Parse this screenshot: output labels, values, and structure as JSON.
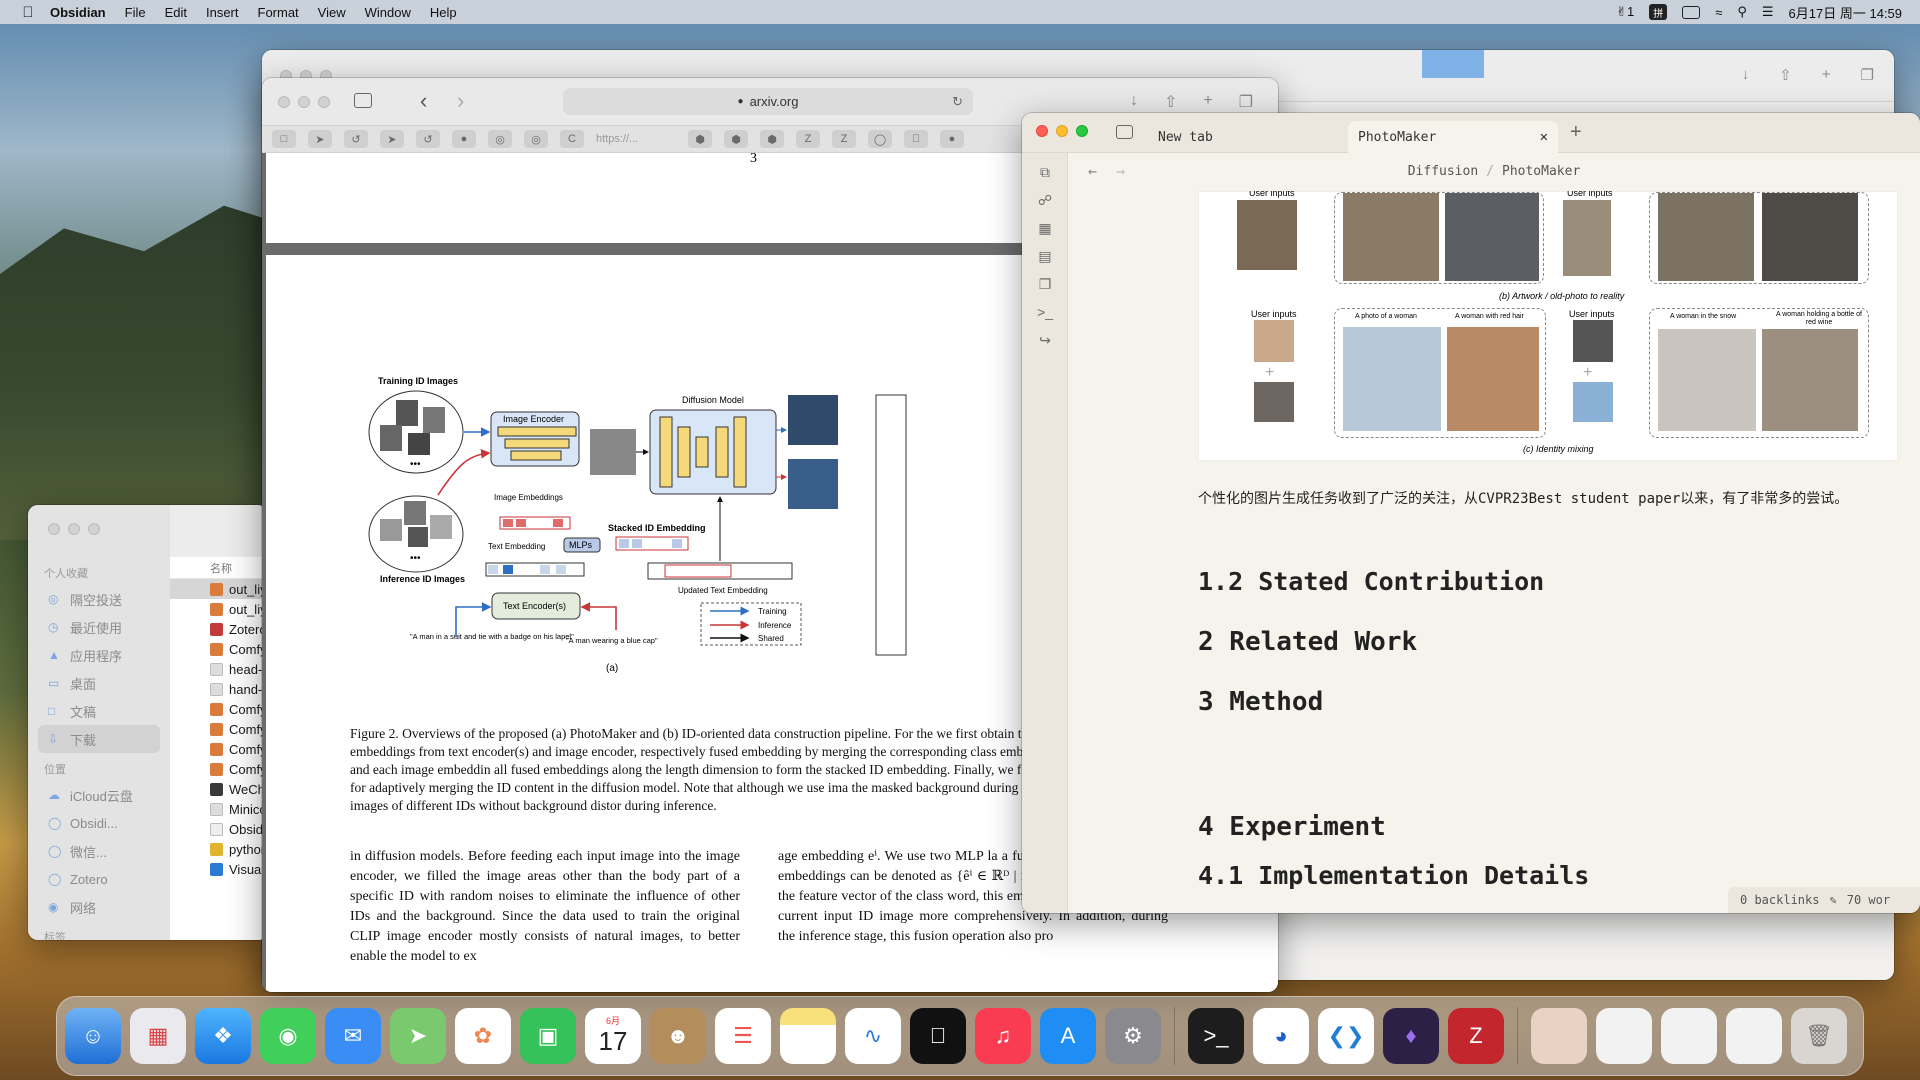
{
  "menubar": {
    "app": "Obsidian",
    "items": [
      "File",
      "Edit",
      "Insert",
      "Format",
      "View",
      "Window",
      "Help"
    ],
    "status": {
      "badge": "1",
      "input": "拼",
      "clock": "6月17日 周一 14:59"
    }
  },
  "safari": {
    "url": "arxiv.org",
    "fav_text": "https://...",
    "page_num": "3"
  },
  "figure": {
    "training_label": "Training ID Images",
    "inference_label": "Inference ID Images",
    "image_encoder": "Image Encoder",
    "diffusion": "Diffusion Model",
    "image_embeddings": "Image Embeddings",
    "text_embedding": "Text Embedding",
    "mlps": "MLPs",
    "stacked": "Stacked ID Embedding",
    "updated": "Updated Text Embedding",
    "text_encoder": "Text Encoder(s)",
    "prompt1": "\"A man in a suit and tie with a badge on his lapel\"",
    "prompt2": "\"A man wearing a blue cap\"",
    "legend": [
      "Training",
      "Inference",
      "Shared"
    ],
    "sub": "(a)",
    "colors": {
      "training": "#2d6fc2",
      "inference": "#c8363a",
      "shared": "#111111"
    }
  },
  "paper": {
    "caption": "Figure 2. Overviews of the proposed (a) PhotoMaker and (b) ID-oriented data construction pipeline. For the we first obtain the text embedding and image embeddings from text encoder(s) and image encoder, respectively fused embedding by merging the corresponding class embedding (e.g., man and woman) and each image embeddin all fused embeddings along the length dimension to form the stacked ID embedding. Finally, we feed the stack cross-attention layers for adaptively merging the ID content in the diffusion model. Note that although we use ima the masked background during training, we can directly input images of different IDs without background distor during inference.",
    "col1": "in diffusion models. Before feeding each input image into the image encoder, we filled the image areas other than the body part of a specific ID with random noises to eliminate the influence of other IDs and the background. Since the data used to train the original CLIP image encoder mostly consists of natural images, to better enable the model to ex",
    "col2": "age embedding eⁱ. We use two MLP la a fusion operation. The fused embeddings can be denoted as {êⁱ ∈ ℝᴰ | i = 1…N}. By combining the feature vector of the class word, this embedding can represent the current input ID image more comprehensively. In addition, during the inference stage, this fusion operation also pro"
  },
  "finder": {
    "favorites_label": "个人收藏",
    "favorites": [
      "隔空投送",
      "最近使用",
      "应用程序",
      "桌面",
      "文稿",
      "下载"
    ],
    "locations_label": "位置",
    "locations": [
      "iCloud云盘",
      "Obsidi...",
      "微信...",
      "Zotero",
      "网络"
    ],
    "tags_label": "标签",
    "col_header": "名称",
    "files": [
      "out_liy",
      "out_liy",
      "Zoterc",
      "Comfy",
      "head-a",
      "hand-t",
      "Comfy",
      "Comfy",
      "Comfy",
      "Comfy",
      "WeCha",
      "Minicc",
      "Obsidi",
      "python",
      "Visual"
    ]
  },
  "obsidian": {
    "tabs": [
      "New tab",
      "PhotoMaker"
    ],
    "breadcrumb": [
      "Diffusion",
      "PhotoMaker"
    ],
    "panel": {
      "user_inputs": "User inputs",
      "caption_b": "(b) Artwork / old-photo to reality",
      "caption_c": "(c) Identity mixing",
      "p1": "A photo of a woman",
      "p2": "A woman with red hair",
      "p3": "A woman in the snow",
      "p4": "A woman holding a bottle of red wine"
    },
    "paragraph": "个性化的图片生成任务收到了广泛的关注，从CVPR23Best student paper以来，有了非常多的尝试。",
    "headings": [
      "1.2 Stated Contribution",
      "2 Related Work",
      "3 Method",
      "4 Experiment",
      "4.1 Implementation Details"
    ],
    "status": {
      "backlinks": "0 backlinks",
      "words": "70 wor"
    }
  },
  "dock": [
    "Finder",
    "Launchpad",
    "Safari",
    "Messages",
    "Mail",
    "Maps",
    "Photos",
    "FaceTime",
    "Calendar",
    "Contacts",
    "Reminders",
    "Notes",
    "Freeform",
    "TV",
    "Music",
    "App Store",
    "System Settings",
    "Terminal",
    "Edge",
    "VS Code",
    "Obsidian",
    "Zotero",
    "Portrait",
    "Screenshots",
    "Windows",
    "Windows",
    "Trash"
  ],
  "dock_calendar": {
    "month": "6月",
    "day": "17"
  }
}
